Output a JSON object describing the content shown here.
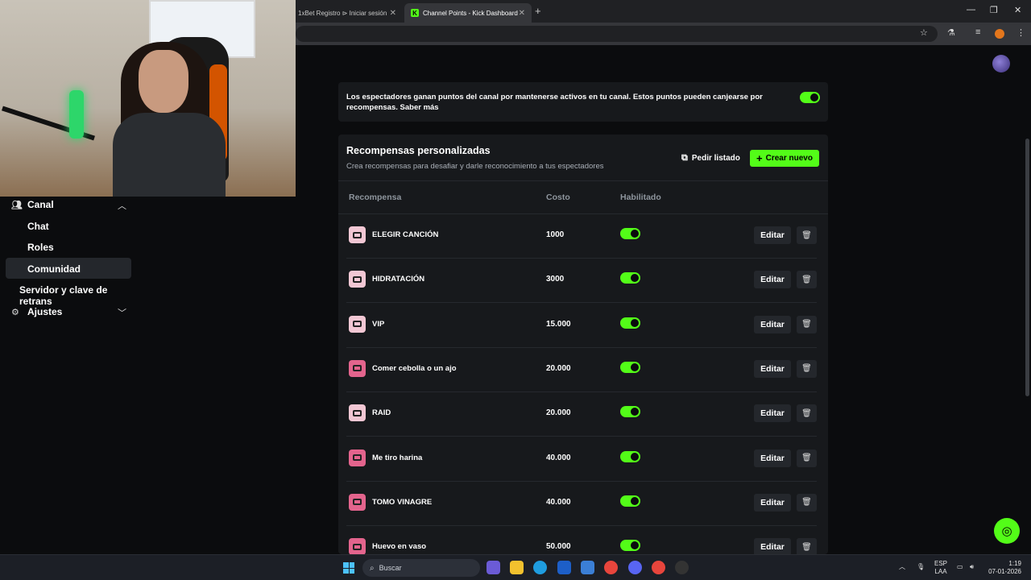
{
  "browser": {
    "tabs": [
      {
        "title": "1xBet Registro ⊳ Iniciar sesión",
        "active": false
      },
      {
        "title": "Channel Points - Kick Dashboard",
        "active": true
      }
    ],
    "new_tab": "+"
  },
  "sidebar": {
    "items": [
      {
        "label": "Canal",
        "icon": "people-icon",
        "expanded": true
      },
      {
        "label": "Chat"
      },
      {
        "label": "Roles"
      },
      {
        "label": "Comunidad",
        "active": true
      },
      {
        "label": "Servidor y clave de retrans"
      },
      {
        "label": "Ajustes",
        "icon": "gear-icon",
        "expanded": false
      }
    ]
  },
  "info": {
    "text": "Los espectadores ganan puntos del canal por mantenerse activos en tu canal. Estos puntos pueden canjearse por recompensas. Saber más",
    "enabled": true
  },
  "rewards": {
    "title": "Recompensas personalizadas",
    "subtitle": "Crea recompensas para desafiar y darle reconocimiento a tus espectadores",
    "list_button": "Pedir listado",
    "create_button": "Crear nuevo",
    "columns": {
      "reward": "Recompensa",
      "cost": "Costo",
      "enabled": "Habilitado"
    },
    "edit_label": "Editar",
    "rows": [
      {
        "name": "ELEGIR CANCIÓN",
        "cost": "1000",
        "enabled": true,
        "icon_color": "#f2c7d4"
      },
      {
        "name": "HIDRATACIÓN",
        "cost": "3000",
        "enabled": true,
        "icon_color": "#f2c7d4"
      },
      {
        "name": "VIP",
        "cost": "15.000",
        "enabled": true,
        "icon_color": "#f2c7d4"
      },
      {
        "name": "Comer cebolla o un ajo",
        "cost": "20.000",
        "enabled": true,
        "icon_color": "#e3648d"
      },
      {
        "name": "RAID",
        "cost": "20.000",
        "enabled": true,
        "icon_color": "#f2c7d4"
      },
      {
        "name": "Me tiro harina",
        "cost": "40.000",
        "enabled": true,
        "icon_color": "#e3648d"
      },
      {
        "name": "TOMO VINAGRE",
        "cost": "40.000",
        "enabled": true,
        "icon_color": "#e3648d"
      },
      {
        "name": "Huevo en vaso",
        "cost": "50.000",
        "enabled": true,
        "icon_color": "#e3648d"
      }
    ]
  },
  "taskbar": {
    "search_placeholder": "Buscar",
    "lang": "ESP",
    "lang_sub": "LAA",
    "time": "1:19",
    "date": "07-01-2026"
  },
  "colors": {
    "accent": "#53fc18",
    "background": "#0b0c0e",
    "card": "#17191c"
  }
}
